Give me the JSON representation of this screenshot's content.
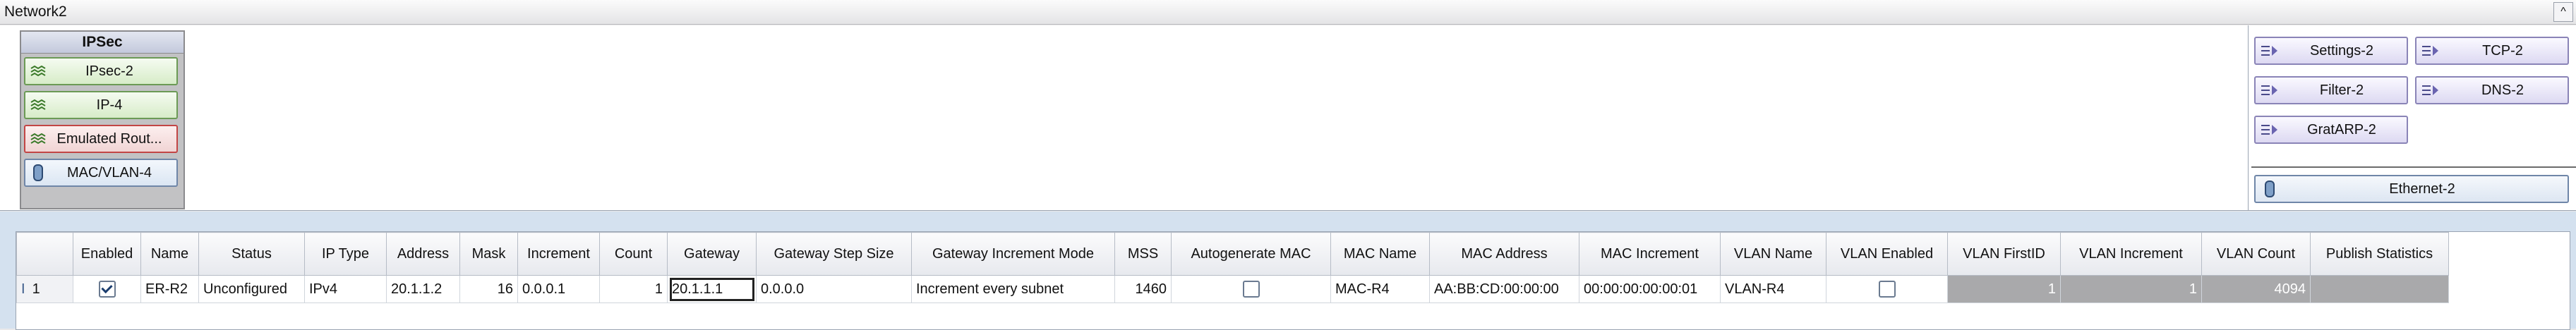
{
  "window": {
    "title": "Network2",
    "collapse_glyph": "^"
  },
  "group": {
    "title": "IPSec",
    "nodes": [
      {
        "label": "IPsec-2",
        "icon": "stack-layers-icon"
      },
      {
        "label": "IP-4",
        "icon": "stack-layers-icon"
      },
      {
        "label": "Emulated Rout...",
        "icon": "stack-layers-icon"
      },
      {
        "label": "MAC/VLAN-4",
        "icon": "cylinder-icon"
      }
    ]
  },
  "plugins": [
    {
      "label": "Settings-2",
      "icon": "plugin-arrow-icon"
    },
    {
      "label": "TCP-2",
      "icon": "plugin-arrow-icon"
    },
    {
      "label": "Filter-2",
      "icon": "plugin-arrow-icon"
    },
    {
      "label": "DNS-2",
      "icon": "plugin-arrow-icon"
    },
    {
      "label": "GratARP-2",
      "icon": "plugin-arrow-icon"
    }
  ],
  "ethernet": {
    "label": "Ethernet-2",
    "icon": "cylinder-icon"
  },
  "grid": {
    "columns": [
      "Enabled",
      "Name",
      "Status",
      "IP Type",
      "Address",
      "Mask",
      "Increment",
      "Count",
      "Gateway",
      "Gateway Step Size",
      "Gateway Increment Mode",
      "MSS",
      "Autogenerate MAC",
      "MAC Name",
      "MAC Address",
      "MAC Increment",
      "VLAN Name",
      "VLAN Enabled",
      "VLAN FirstID",
      "VLAN Increment",
      "VLAN Count",
      "Publish Statistics"
    ],
    "row": {
      "index": "1",
      "enabled": true,
      "name": "ER-R2",
      "status": "Unconfigured",
      "ip_type": "IPv4",
      "address": "20.1.1.2",
      "mask": "16",
      "increment": "0.0.0.1",
      "count": "1",
      "gateway": "20.1.1.1",
      "gateway_step": "0.0.0.0",
      "gateway_mode": "Increment every subnet",
      "mss": "1460",
      "autogen_mac": false,
      "mac_name": "MAC-R4",
      "mac_address": "AA:BB:CD:00:00:00",
      "mac_increment": "00:00:00:00:00:01",
      "vlan_name": "VLAN-R4",
      "vlan_enabled": false,
      "vlan_first_id": "1",
      "vlan_increment": "1",
      "vlan_count": "4094",
      "publish_statistics": ""
    }
  }
}
